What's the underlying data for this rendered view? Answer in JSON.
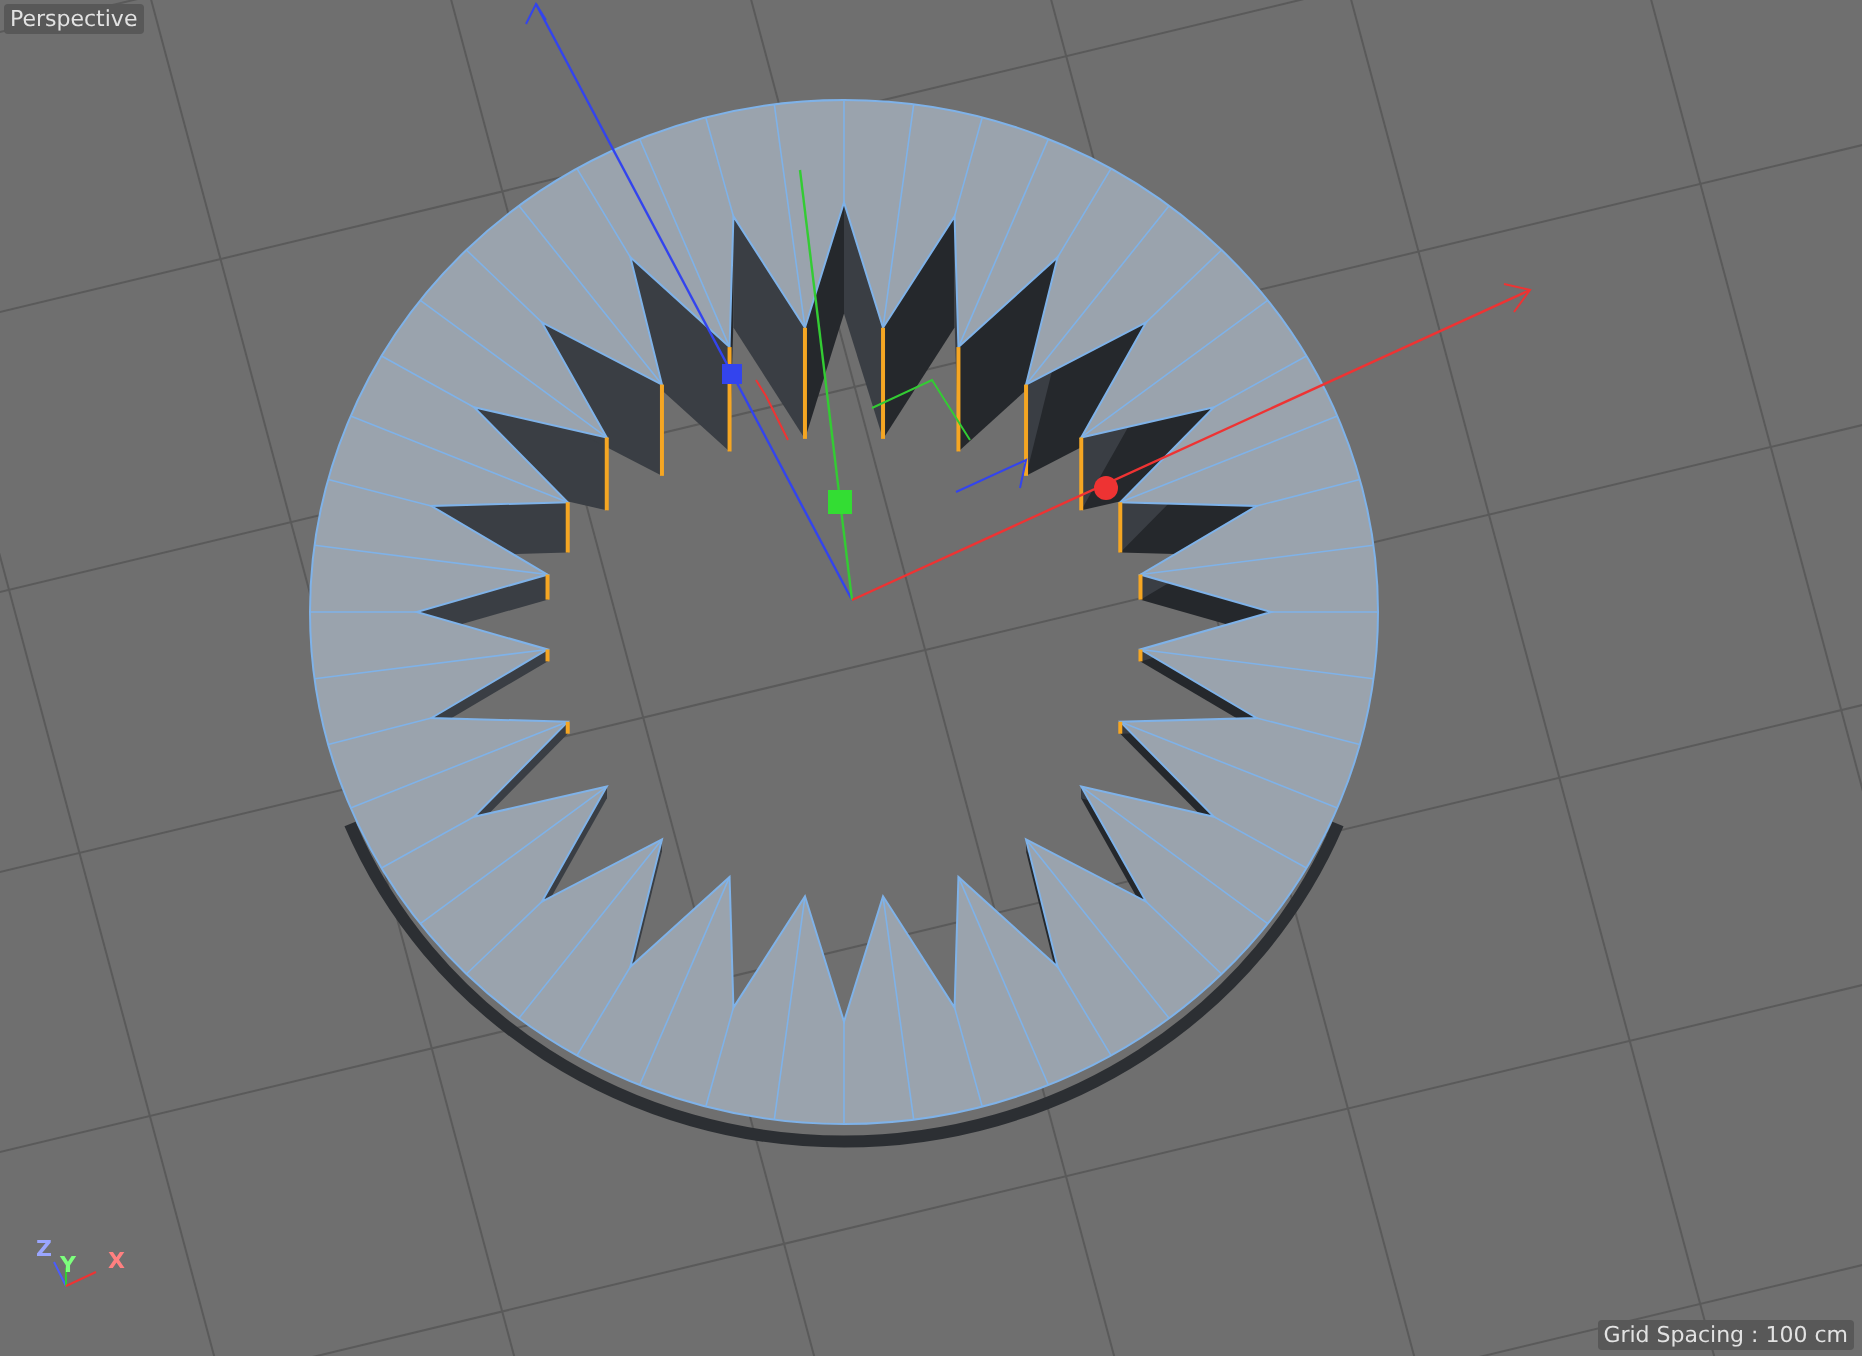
{
  "viewport": {
    "title": "Perspective",
    "grid_spacing": "Grid Spacing : 100 cm"
  },
  "axis_gizmo": {
    "labels": [
      "Z",
      "Y",
      "X"
    ]
  }
}
